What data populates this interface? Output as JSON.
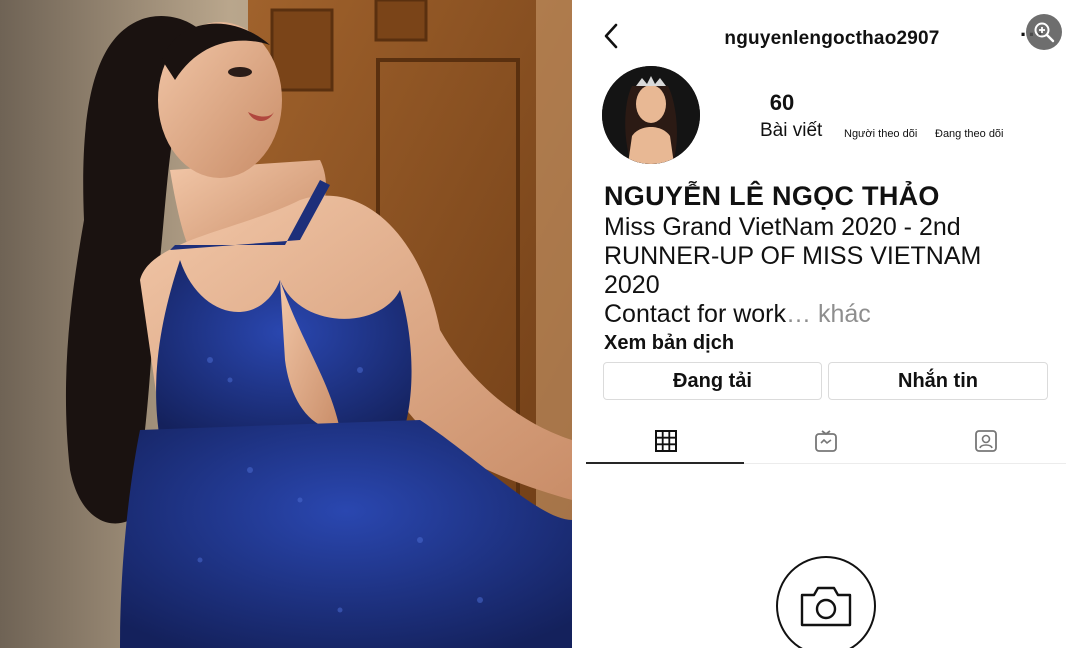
{
  "profile": {
    "username": "nguyenlengocthao2907",
    "more_glyph": "···",
    "stats": {
      "posts_count": "60",
      "posts_label": "Bài viết",
      "followers_label": "Người theo dõi",
      "following_label": "Đang theo dõi"
    },
    "bio": {
      "name": "NGUYỄN LÊ NGỌC THẢO",
      "line1": "Miss Grand VietNam 2020 - 2nd",
      "line2": "RUNNER-UP OF MISS VIETNAM",
      "line3": "2020",
      "contact": "Contact for work",
      "more": "… khác",
      "translate": "Xem bản dịch"
    },
    "buttons": {
      "edit_label": "Đang tải",
      "message_label": "Nhắn tin"
    },
    "tabs": [
      {
        "icon": "grid-icon",
        "active": true
      },
      {
        "icon": "igtv-icon",
        "active": false
      },
      {
        "icon": "tagged-icon",
        "active": false
      }
    ]
  },
  "colors": {
    "dress_blue": "#1d2f7a",
    "text_primary": "#111111",
    "text_secondary": "#8e8e8e",
    "border": "#dbdbdb"
  }
}
